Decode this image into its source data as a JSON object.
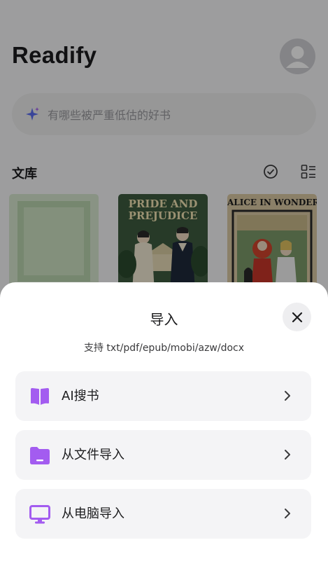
{
  "app": {
    "title": "Readify"
  },
  "search": {
    "placeholder": "有哪些被严重低估的好书"
  },
  "library": {
    "title": "文库"
  },
  "books": [
    {
      "title": ""
    },
    {
      "title": "PRIDE AND PREJUDICE"
    },
    {
      "title": "ALICE IN WONDERLAND"
    }
  ],
  "import_sheet": {
    "title": "导入",
    "subtitle": "支持 txt/pdf/epub/mobi/azw/docx",
    "options": [
      {
        "label": "AI搜书",
        "icon": "book-icon"
      },
      {
        "label": "从文件导入",
        "icon": "folder-icon"
      },
      {
        "label": "从电脑导入",
        "icon": "monitor-icon"
      }
    ]
  },
  "colors": {
    "accent": "#a35cf0",
    "overlay": "rgba(0,0,0,0.36)"
  }
}
